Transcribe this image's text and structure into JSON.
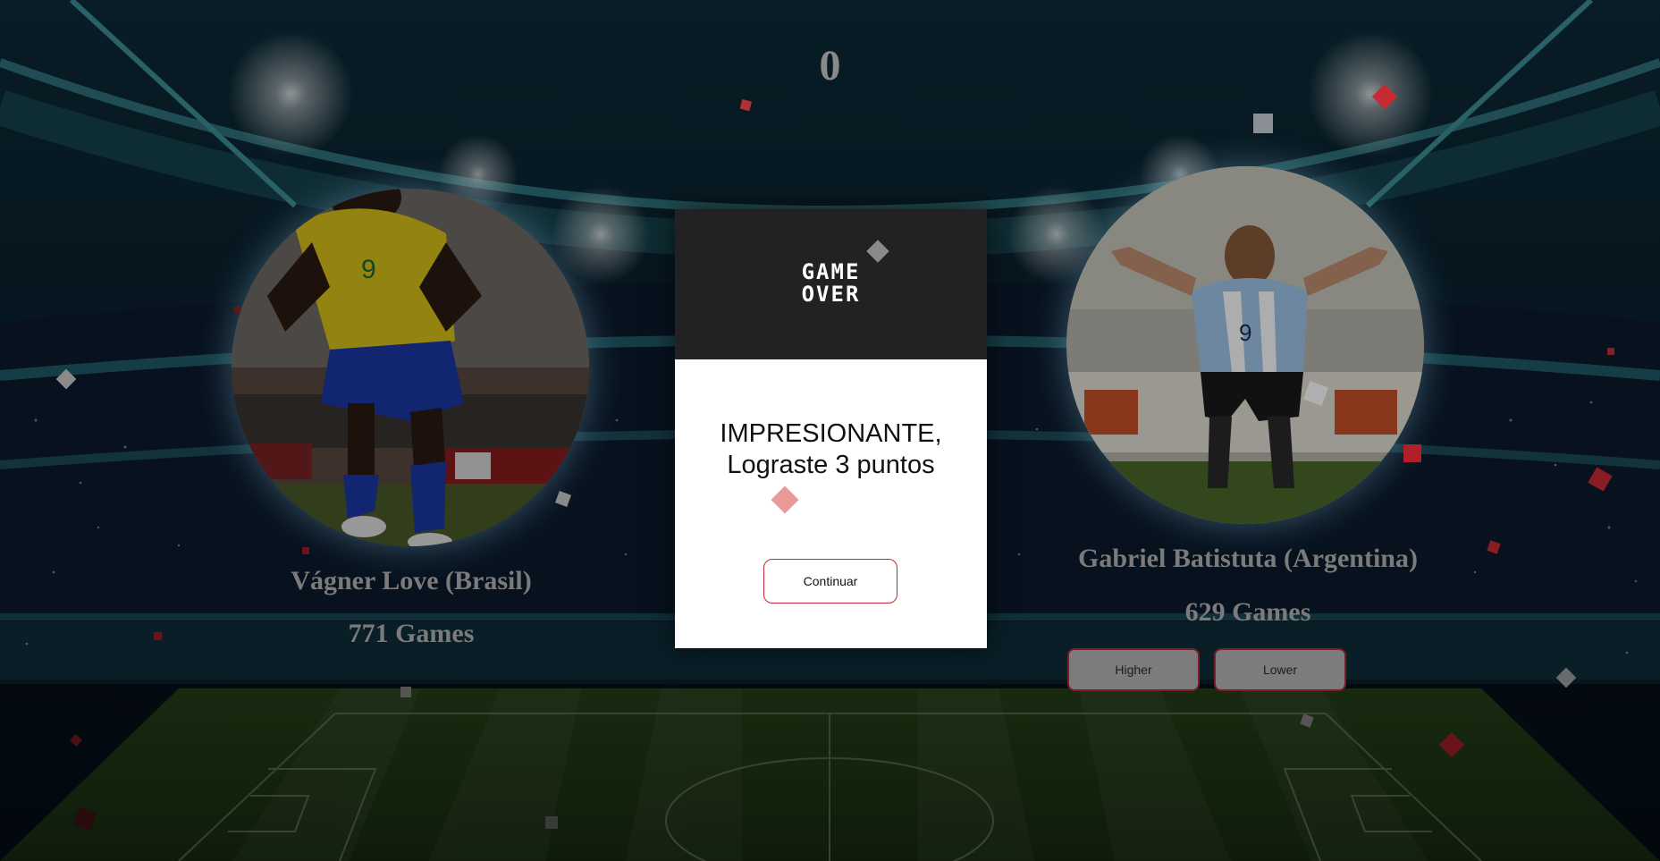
{
  "score": "0",
  "left_player": {
    "name": "Vágner Love (Brasil)",
    "games": "771 Games",
    "photo_alt": "Vágner Love"
  },
  "right_player": {
    "name": "Gabriel Batistuta (Argentina)",
    "games": "629 Games",
    "photo_alt": "Gabriel Batistuta"
  },
  "buttons": {
    "higher": "Higher",
    "lower": "Lower"
  },
  "modal": {
    "title_line1": "GAME",
    "title_line2": "OVER",
    "message_line1": "IMPRESIONANTE,",
    "message_line2": "Lograste 3 puntos",
    "continue_label": "Continuar"
  },
  "colors": {
    "modal_header": "#222225",
    "button_border": "#c62a32",
    "brazil_yellow": "#f2d21a",
    "argentina_blue": "#9fc7ea",
    "pitch_green": "#3e6a28"
  }
}
